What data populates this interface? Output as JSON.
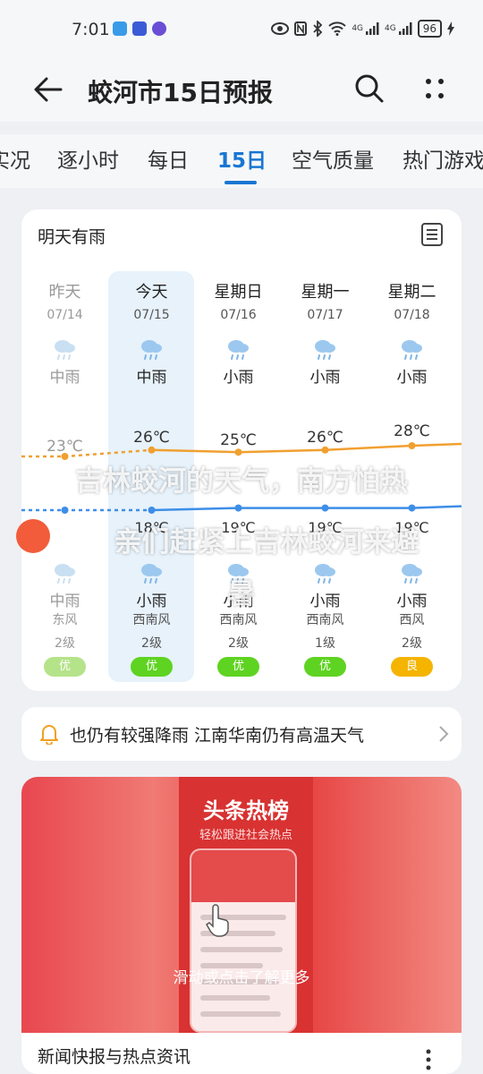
{
  "status_bar": {
    "time": "7:01",
    "network_labels": [
      "4G",
      "4G"
    ],
    "battery": "96"
  },
  "header": {
    "title": "蛟河市15日预报"
  },
  "tabs": [
    {
      "label": "实况",
      "active": false
    },
    {
      "label": "逐小时",
      "active": false
    },
    {
      "label": "每日",
      "active": false
    },
    {
      "label": "15日",
      "active": true
    },
    {
      "label": "空气质量",
      "active": false
    },
    {
      "label": "热门游戏",
      "active": false
    }
  ],
  "forecast": {
    "summary": "明天有雨",
    "days": [
      {
        "name": "昨天",
        "date": "07/14",
        "day_condition": "中雨",
        "high": "23℃",
        "low": "",
        "night_condition": "中雨",
        "wind_dir": "东风",
        "wind_level": "2级",
        "aqi": "优",
        "aqi_color": "#b5e38a",
        "past": true
      },
      {
        "name": "今天",
        "date": "07/15",
        "day_condition": "中雨",
        "high": "26℃",
        "low": "18℃",
        "night_condition": "小雨",
        "wind_dir": "西南风",
        "wind_level": "2级",
        "aqi": "优",
        "aqi_color": "#5fd321",
        "past": false
      },
      {
        "name": "星期日",
        "date": "07/16",
        "day_condition": "小雨",
        "high": "25℃",
        "low": "19℃",
        "night_condition": "小雨",
        "wind_dir": "西南风",
        "wind_level": "2级",
        "aqi": "优",
        "aqi_color": "#5fd321",
        "past": false
      },
      {
        "name": "星期一",
        "date": "07/17",
        "day_condition": "小雨",
        "high": "26℃",
        "low": "19℃",
        "night_condition": "小雨",
        "wind_dir": "西南风",
        "wind_level": "1级",
        "aqi": "优",
        "aqi_color": "#5fd321",
        "past": false
      },
      {
        "name": "星期二",
        "date": "07/18",
        "day_condition": "小雨",
        "high": "28℃",
        "low": "19℃",
        "night_condition": "小雨",
        "wind_dir": "西风",
        "wind_level": "2级",
        "aqi": "良",
        "aqi_color": "#f5b400",
        "past": false
      }
    ],
    "high_values": [
      23,
      26,
      25,
      26,
      28
    ],
    "low_values": [
      18,
      18,
      19,
      19,
      19
    ],
    "high_line_color": "#f0a030",
    "low_line_color": "#3d8ee8"
  },
  "caption": {
    "line1": "吉林蛟河的天气，南方怕热",
    "line2": "亲们赶紧上吉林蛟河来避",
    "line3": "暑"
  },
  "notice": {
    "text": "也仍有较强降雨 江南华南仍有高温天气"
  },
  "news": {
    "banner_title": "头条热榜",
    "banner_subtitle": "轻松跟进社会热点",
    "banner_hint": "滑动或点击了解更多",
    "title": "新闻快报与热点资讯"
  }
}
